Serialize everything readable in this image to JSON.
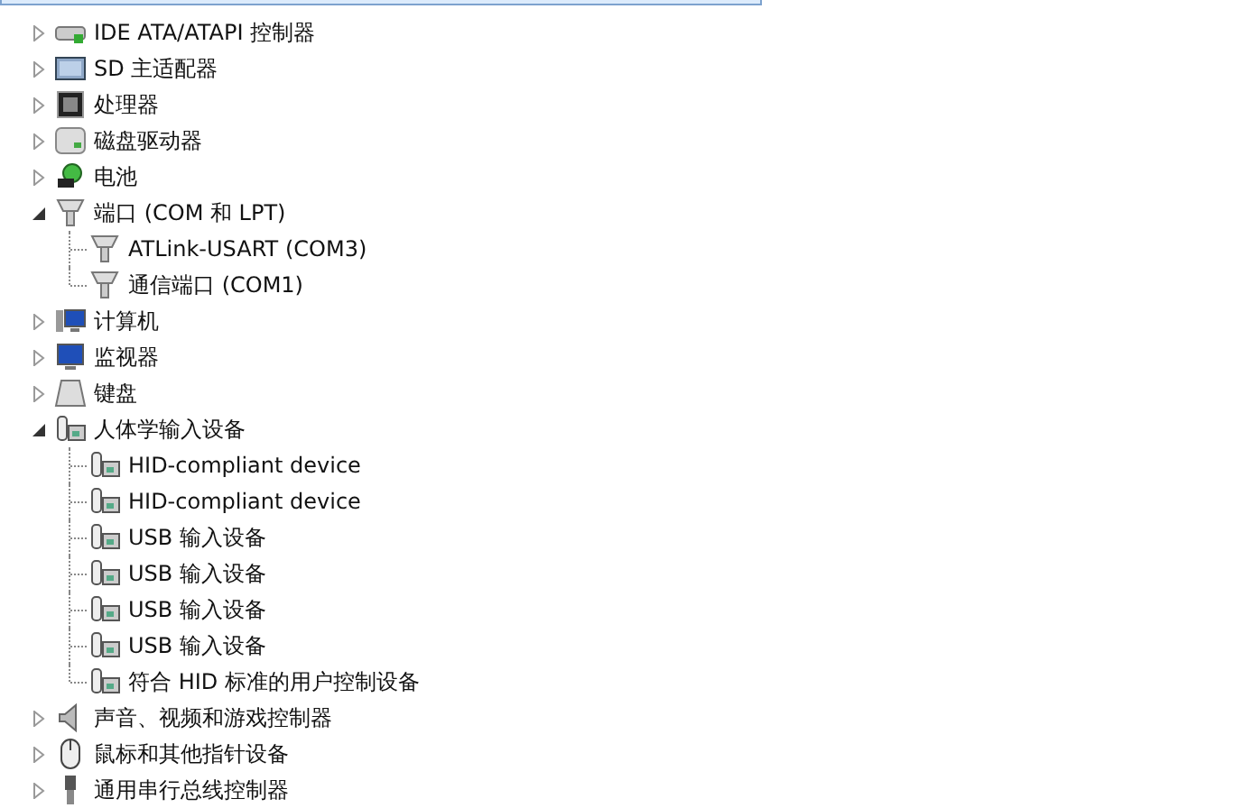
{
  "tree": [
    {
      "label": "IDE ATA/ATAPI 控制器",
      "kind": "ide",
      "expanded": false
    },
    {
      "label": "SD 主适配器",
      "kind": "sd",
      "expanded": false
    },
    {
      "label": "处理器",
      "kind": "cpu",
      "expanded": false
    },
    {
      "label": "磁盘驱动器",
      "kind": "disk",
      "expanded": false
    },
    {
      "label": "电池",
      "kind": "battery",
      "expanded": false
    },
    {
      "label": "端口 (COM 和 LPT)",
      "kind": "port",
      "expanded": true,
      "children": [
        {
          "label": "ATLink-USART (COM3)",
          "kind": "port"
        },
        {
          "label": "通信端口 (COM1)",
          "kind": "port"
        }
      ]
    },
    {
      "label": "计算机",
      "kind": "computer",
      "expanded": false
    },
    {
      "label": "监视器",
      "kind": "monitor",
      "expanded": false
    },
    {
      "label": "键盘",
      "kind": "keyboard",
      "expanded": false
    },
    {
      "label": "人体学输入设备",
      "kind": "hid",
      "expanded": true,
      "children": [
        {
          "label": "HID-compliant device",
          "kind": "hid"
        },
        {
          "label": "HID-compliant device",
          "kind": "hid"
        },
        {
          "label": "USB 输入设备",
          "kind": "hid"
        },
        {
          "label": "USB 输入设备",
          "kind": "hid"
        },
        {
          "label": "USB 输入设备",
          "kind": "hid"
        },
        {
          "label": "USB 输入设备",
          "kind": "hid"
        },
        {
          "label": "符合 HID 标准的用户控制设备",
          "kind": "hid"
        }
      ]
    },
    {
      "label": "声音、视频和游戏控制器",
      "kind": "sound",
      "expanded": false
    },
    {
      "label": "鼠标和其他指针设备",
      "kind": "mouse",
      "expanded": false
    },
    {
      "label": "通用串行总线控制器",
      "kind": "usb",
      "expanded": false
    }
  ]
}
